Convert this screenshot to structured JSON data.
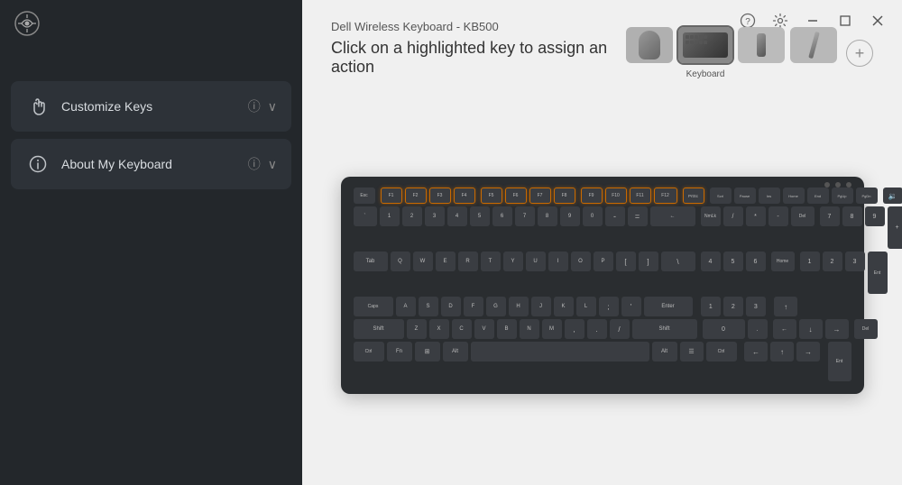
{
  "sidebar": {
    "logo_label": "Dell Peripheral Manager",
    "items": [
      {
        "id": "customize-keys",
        "label": "Customize Keys",
        "icon": "hand-pointer-icon",
        "has_info": true,
        "has_chevron": true
      },
      {
        "id": "about-keyboard",
        "label": "About My Keyboard",
        "icon": "info-circle-icon",
        "has_info": true,
        "has_chevron": true
      }
    ]
  },
  "main": {
    "device_name": "Dell Wireless Keyboard - KB500",
    "instruction": "Click on a highlighted key to assign an action",
    "thumbnails": [
      {
        "id": "thumb-receiver",
        "label": ""
      },
      {
        "id": "thumb-keyboard",
        "label": "Keyboard",
        "active": true
      },
      {
        "id": "thumb-dongle",
        "label": ""
      },
      {
        "id": "thumb-pen",
        "label": ""
      }
    ],
    "add_device_label": "+"
  },
  "titlebar": {
    "help_label": "?",
    "settings_label": "⚙",
    "minimize_label": "—",
    "maximize_label": "□",
    "close_label": "✕"
  },
  "keyboard": {
    "highlighted_row_label": "Function keys row"
  }
}
